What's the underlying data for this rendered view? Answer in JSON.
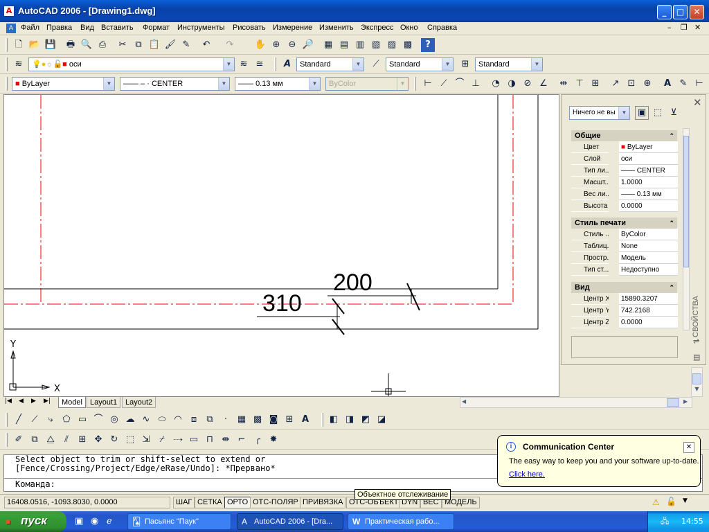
{
  "window": {
    "title": "AutoCAD 2006 - [Drawing1.dwg]"
  },
  "menu": [
    "Файл",
    "Правка",
    "Вид",
    "Вставить",
    "Формат",
    "Инструменты",
    "Рисовать",
    "Измерение",
    "Изменить",
    "Экспресс",
    "Окно",
    "Справка"
  ],
  "layers": {
    "current": "оси"
  },
  "styles": {
    "text": "Standard",
    "dim": "Standard",
    "table": "Standard"
  },
  "properties_bar": {
    "color": "ByLayer",
    "linetype": "CENTER",
    "linetype_prefix": "—— – ·",
    "lineweight": "0.13 мм",
    "plotstyle": "ByColor"
  },
  "drawing": {
    "dim1": "200",
    "dim2": "310",
    "ucs_y": "Y",
    "ucs_x": "X"
  },
  "properties_panel": {
    "selection": "Ничего не вы",
    "side_label": "СВОЙСТВА",
    "sections": [
      {
        "title": "Общие",
        "rows": [
          [
            "Цвет",
            "ByLayer"
          ],
          [
            "Слой",
            "оси"
          ],
          [
            "Тип ли...",
            "CENTER"
          ],
          [
            "Масшт...",
            "1.0000"
          ],
          [
            "Вес ли...",
            "0.13 мм"
          ],
          [
            "Высота",
            "0.0000"
          ]
        ]
      },
      {
        "title": "Стиль печати",
        "rows": [
          [
            "Стиль ...",
            "ByColor"
          ],
          [
            "Таблиц...",
            "None"
          ],
          [
            "Простр...",
            "Модель"
          ],
          [
            "Тип ст...",
            "Недоступно"
          ]
        ]
      },
      {
        "title": "Вид",
        "rows": [
          [
            "Центр X",
            "15890.3207"
          ],
          [
            "Центр Y",
            "742.2168"
          ],
          [
            "Центр Z",
            "0.0000"
          ]
        ]
      }
    ]
  },
  "tabs": [
    "Model",
    "Layout1",
    "Layout2"
  ],
  "command": {
    "line1": "Select object to trim or shift-select to extend or",
    "line2": "[Fence/Crossing/Project/Edge/eRase/Undo]: *Прервано*",
    "prompt": "Команда:"
  },
  "status": {
    "coords": "16408.0516, -1093.8030, 0.0000",
    "buttons": [
      "ШАГ",
      "СЕТКА",
      "ОРТО",
      "ОТС-ПОЛЯР",
      "ПРИВЯЗКА",
      "ОТС-ОБЪЕКТ",
      "DYN",
      "ВЕС",
      "МОДЕЛЬ"
    ]
  },
  "tooltip": "Объектное отслеживание",
  "balloon": {
    "title": "Communication Center",
    "text": "The easy way to keep you and your software up-to-date.",
    "link": "Click here."
  },
  "taskbar": {
    "start": "пуск",
    "tasks": [
      "Пасьянс \"Паук\"",
      "AutoCAD 2006 - [Dra...",
      "Практическая рабо..."
    ],
    "clock": "14:55"
  }
}
